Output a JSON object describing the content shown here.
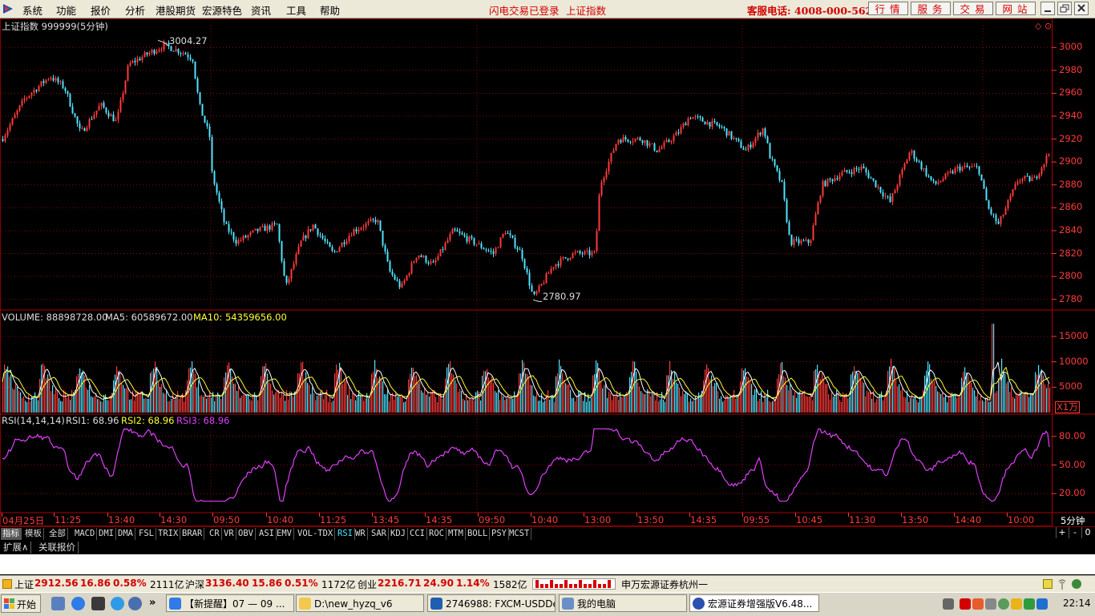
{
  "menubar": {
    "items": [
      "系统",
      "功能",
      "报价",
      "分析",
      "港股期货",
      "宏源特色",
      "资讯",
      "工具",
      "帮助"
    ],
    "login_status": "闪电交易已登录",
    "current_index": "上证指数",
    "hotline": "客服电话: 4008-000-562",
    "nav_buttons": [
      "行情",
      "服务",
      "交易",
      "网站"
    ]
  },
  "price_chart": {
    "title": "上证指数 999999(5分钟)",
    "high_label": "3004.27",
    "low_label": "2780.97",
    "y_ticks": [
      "3000",
      "2980",
      "2960",
      "2940",
      "2920",
      "2900",
      "2880",
      "2860",
      "2840",
      "2820",
      "2800",
      "2780"
    ]
  },
  "volume_chart": {
    "label_volume": "VOLUME: 88898728.00",
    "label_ma5": "MA5: 60589672.00",
    "label_ma10": "MA10: 54359656.00",
    "y_ticks": [
      "15000",
      "10000",
      "5000"
    ],
    "unit": "X1万"
  },
  "rsi_chart": {
    "label_params": "RSI(14,14,14)",
    "label_rsi1": "RSI1: 68.96",
    "label_rsi2": "RSI2: 68.96",
    "label_rsi3": "RSI3: 68.96",
    "y_ticks": [
      "80.00",
      "50.00",
      "20.00"
    ]
  },
  "time_axis": {
    "labels": [
      "04月25日",
      "11:25",
      "13:40",
      "14:30",
      "09:50",
      "10:40",
      "11:25",
      "13:45",
      "14:35",
      "09:50",
      "10:40",
      "13:00",
      "13:50",
      "14:35",
      "09:55",
      "10:45",
      "11:30",
      "13:50",
      "14:40",
      "10:00"
    ],
    "period": "5分钟"
  },
  "indicator_tabs": [
    "指标",
    "模板",
    "全部",
    "MACD",
    "DMI",
    "DMA",
    "FSL",
    "TRIX",
    "BRAR",
    "CR",
    "VR",
    "OBV",
    "ASI",
    "EMV",
    "VOL-TDX",
    "RSI",
    "WR",
    "SAR",
    "KDJ",
    "CCI",
    "ROC",
    "MTM",
    "BOLL",
    "PSY",
    "MCST"
  ],
  "active_indicator": "RSI",
  "zoom_buttons": [
    "+",
    "-",
    "0"
  ],
  "extra_tabs": [
    "扩展∧",
    "关联报价"
  ],
  "ticker": {
    "sh_name": "上证",
    "sh_price": "2912.56",
    "sh_change": "16.86",
    "sh_pct": "0.58%",
    "sh_amount": "2111亿",
    "sz_name": "沪深",
    "sz_price": "3136.40",
    "sz_change": "15.86",
    "sz_pct": "0.51%",
    "sz_amount": "1172亿",
    "cy_name": "创业",
    "cy_price": "2216.71",
    "cy_change": "24.90",
    "cy_pct": "1.14%",
    "cy_amount": "1582亿",
    "broker": "申万宏源证券杭州一"
  },
  "taskbar": {
    "start": "开始",
    "windows": [
      "【新提醒】07 — 09 ...",
      "D:\\new_hyzq_v6",
      "2746988: FXCM-USDDe...",
      "我的电脑",
      "宏源证券增强版V6.48..."
    ],
    "clock": "22:14"
  },
  "colors": {
    "up": "#ff3a3a",
    "down": "#4fe3ff",
    "rsi": "#e040fb",
    "ma5": "#ffffff",
    "ma10": "#ffff33",
    "grid": "#8b0000"
  },
  "chart_data": [
    {
      "type": "candlestick",
      "title": "上证指数 999999(5分钟)",
      "ylim": [
        2770,
        3010
      ],
      "y_ticks": [
        3000,
        2980,
        2960,
        2940,
        2920,
        2900,
        2880,
        2860,
        2840,
        2820,
        2800,
        2780
      ],
      "marked_high": 3004.27,
      "marked_low": 2780.97
    },
    {
      "type": "bar",
      "title": "VOLUME",
      "ylim": [
        0,
        18000
      ],
      "y_ticks": [
        15000,
        10000,
        5000
      ],
      "unit": "X1万"
    },
    {
      "type": "line",
      "title": "RSI(14,14,14)",
      "ylim": [
        0,
        100
      ],
      "y_ticks": [
        80,
        50,
        20
      ],
      "last_value": 68.96
    }
  ]
}
